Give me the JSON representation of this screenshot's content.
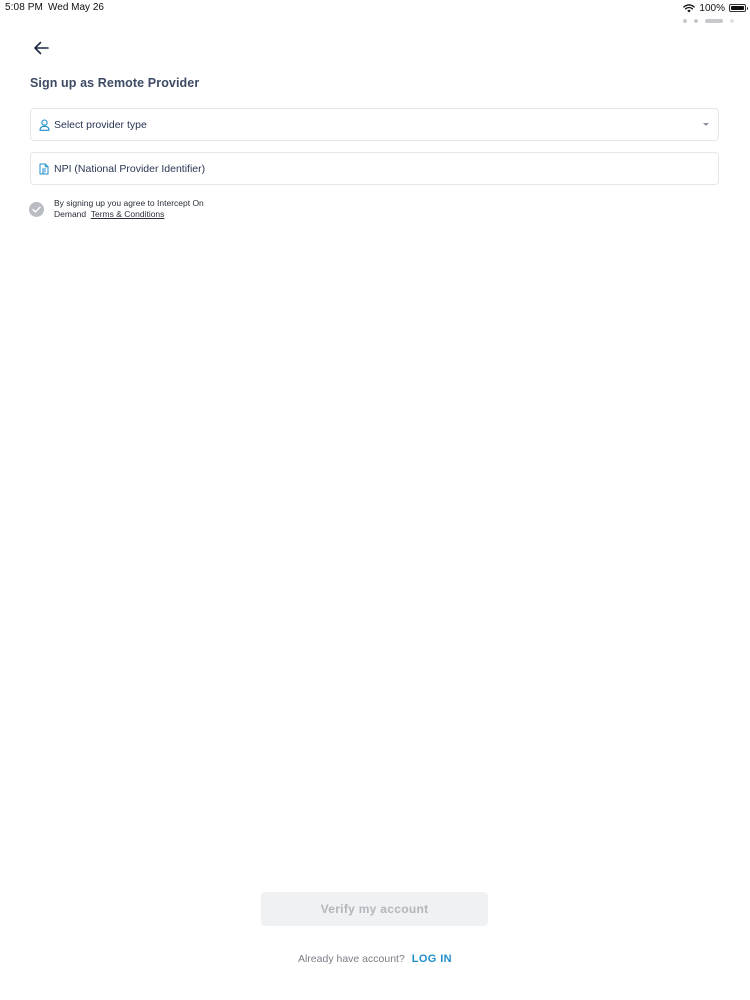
{
  "status_bar": {
    "time": "5:08 PM",
    "date": "Wed May 26",
    "battery_percent": "100%"
  },
  "header": {
    "title": "Sign up as Remote Provider"
  },
  "form": {
    "provider_type": {
      "placeholder": "Select provider type"
    },
    "npi": {
      "placeholder": "NPI (National Provider Identifier)"
    },
    "terms": {
      "prefix": "By signing up you agree to Intercept On Demand",
      "link_label": "Terms & Conditions"
    }
  },
  "actions": {
    "verify_label": "Verify my account",
    "login_prompt": "Already have account?",
    "login_label": "LOG IN"
  },
  "colors": {
    "accent": "#1f8fc9",
    "title": "#3d4a63",
    "disabled_button_bg": "#f0f1f3",
    "disabled_button_text": "#b3b6bc"
  }
}
